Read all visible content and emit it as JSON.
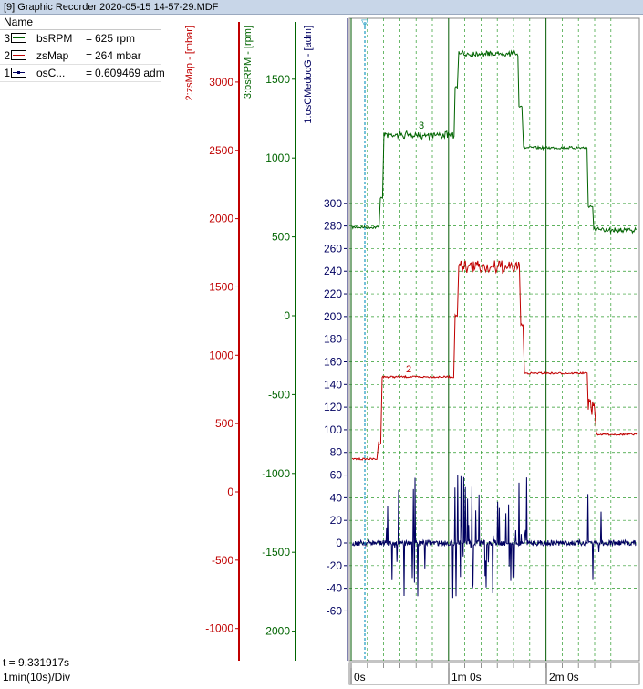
{
  "window": {
    "title": "[9] Graphic Recorder  2020-05-15  14-57-29.MDF"
  },
  "legend": {
    "header": "Name",
    "rows": [
      {
        "index": "3",
        "name": "bsRPM",
        "equals": "=",
        "value": "625 rpm",
        "color": "#006400"
      },
      {
        "index": "2",
        "name": "zsMap",
        "equals": "=",
        "value": "264 mbar",
        "color": "#c00000"
      },
      {
        "index": "1",
        "name": "osC...",
        "equals": "=",
        "value": "0.609469 adm",
        "color": "#000060"
      }
    ]
  },
  "status": {
    "cursor_time": "t = 9.331917s",
    "time_div": "1min(10s)/Div"
  },
  "axes": {
    "zsMap": {
      "label": "2:zsMap - [mbar]",
      "color": "#c00000",
      "ticks": [
        "3000",
        "2500",
        "2000",
        "1500",
        "1000",
        "500",
        "0",
        "-500",
        "-1000"
      ]
    },
    "bsRPM": {
      "label": "3:bsRPM - [rpm]",
      "color": "#006400",
      "ticks": [
        "1500",
        "1000",
        "500",
        "0",
        "-500",
        "-1000",
        "-1500",
        "-2000"
      ]
    },
    "osCMedocG": {
      "label": "1:osCMedocG - [adm]",
      "color": "#000060",
      "ticks": [
        "300",
        "280",
        "260",
        "240",
        "220",
        "200",
        "180",
        "160",
        "140",
        "120",
        "100",
        "80",
        "60",
        "40",
        "20",
        "0",
        "-20",
        "-40",
        "-60"
      ]
    }
  },
  "time_axis": {
    "ticks": [
      "0s",
      "1m 0s",
      "2m 0s"
    ]
  },
  "trace_labels": {
    "bsRPM": "3",
    "zsMap": "2"
  },
  "cursor_marker": "▽"
}
